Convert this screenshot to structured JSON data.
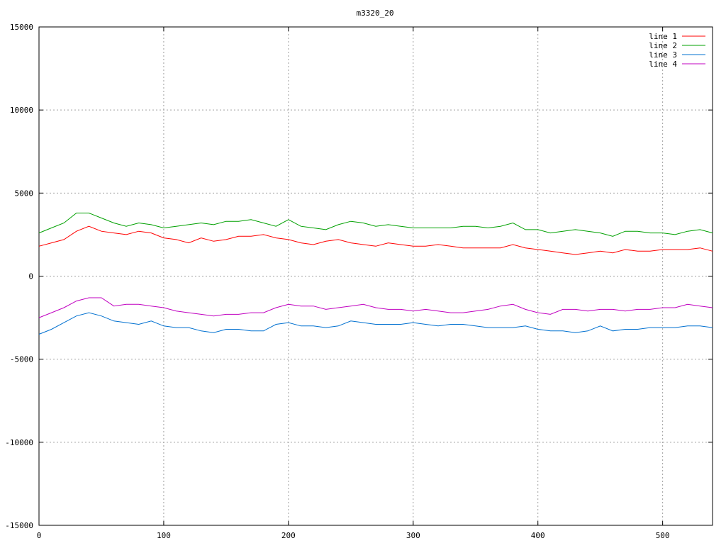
{
  "chart_data": {
    "type": "line",
    "title": "m3320_20",
    "xlabel": "",
    "ylabel": "",
    "xlim": [
      0,
      540
    ],
    "ylim": [
      -15000,
      15000
    ],
    "x_ticks": [
      0,
      100,
      200,
      300,
      400,
      500
    ],
    "y_ticks": [
      -15000,
      -10000,
      -5000,
      0,
      5000,
      10000,
      15000
    ],
    "grid": true,
    "legend_position": "top-right",
    "x_step": 10,
    "series": [
      {
        "name": "line 1",
        "color": "#ff0000",
        "values": [
          1800,
          2000,
          2200,
          2700,
          3000,
          2700,
          2600,
          2500,
          2700,
          2600,
          2300,
          2200,
          2000,
          2300,
          2100,
          2200,
          2400,
          2400,
          2500,
          2300,
          2200,
          2000,
          1900,
          2100,
          2200,
          2000,
          1900,
          1800,
          2000,
          1900,
          1800,
          1800,
          1900,
          1800,
          1700,
          1700,
          1700,
          1700,
          1900,
          1700,
          1600,
          1500,
          1400,
          1300,
          1400,
          1500,
          1400,
          1600,
          1500,
          1500,
          1600,
          1600,
          1600,
          1700,
          1500
        ]
      },
      {
        "name": "line 2",
        "color": "#00a000",
        "values": [
          2600,
          2900,
          3200,
          3800,
          3800,
          3500,
          3200,
          3000,
          3200,
          3100,
          2900,
          3000,
          3100,
          3200,
          3100,
          3300,
          3300,
          3400,
          3200,
          3000,
          3400,
          3000,
          2900,
          2800,
          3100,
          3300,
          3200,
          3000,
          3100,
          3000,
          2900,
          2900,
          2900,
          2900,
          3000,
          3000,
          2900,
          3000,
          3200,
          2800,
          2800,
          2600,
          2700,
          2800,
          2700,
          2600,
          2400,
          2700,
          2700,
          2600,
          2600,
          2500,
          2700,
          2800,
          2600
        ]
      },
      {
        "name": "line 3",
        "color": "#0070d0",
        "values": [
          -3500,
          -3200,
          -2800,
          -2400,
          -2200,
          -2400,
          -2700,
          -2800,
          -2900,
          -2700,
          -3000,
          -3100,
          -3100,
          -3300,
          -3400,
          -3200,
          -3200,
          -3300,
          -3300,
          -2900,
          -2800,
          -3000,
          -3000,
          -3100,
          -3000,
          -2700,
          -2800,
          -2900,
          -2900,
          -2900,
          -2800,
          -2900,
          -3000,
          -2900,
          -2900,
          -3000,
          -3100,
          -3100,
          -3100,
          -3000,
          -3200,
          -3300,
          -3300,
          -3400,
          -3300,
          -3000,
          -3300,
          -3200,
          -3200,
          -3100,
          -3100,
          -3100,
          -3000,
          -3000,
          -3100
        ]
      },
      {
        "name": "line 4",
        "color": "#c000c0",
        "values": [
          -2500,
          -2200,
          -1900,
          -1500,
          -1300,
          -1300,
          -1800,
          -1700,
          -1700,
          -1800,
          -1900,
          -2100,
          -2200,
          -2300,
          -2400,
          -2300,
          -2300,
          -2200,
          -2200,
          -1900,
          -1700,
          -1800,
          -1800,
          -2000,
          -1900,
          -1800,
          -1700,
          -1900,
          -2000,
          -2000,
          -2100,
          -2000,
          -2100,
          -2200,
          -2200,
          -2100,
          -2000,
          -1800,
          -1700,
          -2000,
          -2200,
          -2300,
          -2000,
          -2000,
          -2100,
          -2000,
          -2000,
          -2100,
          -2000,
          -2000,
          -1900,
          -1900,
          -1700,
          -1800,
          -1900
        ]
      }
    ]
  }
}
